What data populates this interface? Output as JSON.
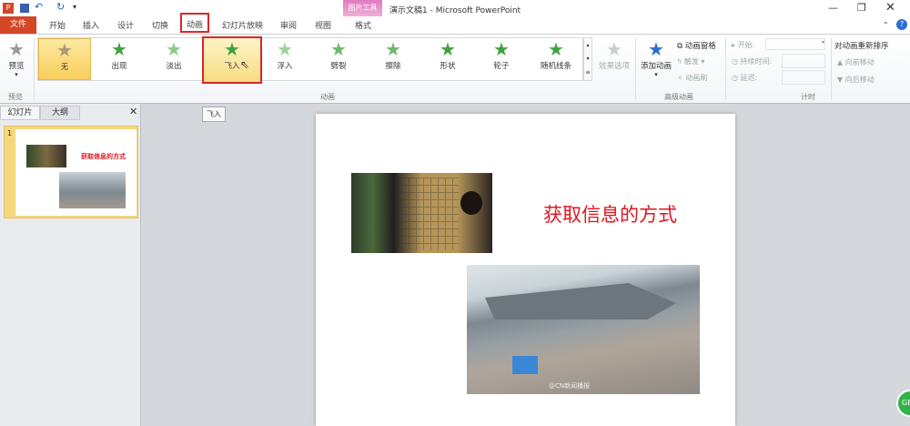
{
  "window": {
    "title": "演示文稿1 - Microsoft PowerPoint",
    "context_group": "图片工具",
    "app_icon": "P"
  },
  "tabs": {
    "file": "文件",
    "items": [
      "开始",
      "插入",
      "设计",
      "切换",
      "动画",
      "幻灯片放映",
      "审阅",
      "视图"
    ],
    "context": "格式"
  },
  "ribbon": {
    "preview": {
      "label": "预览",
      "group": "预览"
    },
    "gallery": [
      "无",
      "出现",
      "淡出",
      "飞入",
      "浮入",
      "劈裂",
      "擦除",
      "形状",
      "轮子",
      "随机线条"
    ],
    "effect_options": "效果选项",
    "group_animation": "动画",
    "add_animation": "添加动画",
    "animation_pane": "动画窗格",
    "trigger": "触发",
    "animation_painter": "动画刷",
    "group_advanced": "高级动画",
    "start_label": "开始:",
    "duration_label": "持续时间:",
    "delay_label": "延迟:",
    "group_timing": "计时",
    "reorder_title": "对动画重新排序",
    "move_earlier": "向前移动",
    "move_later": "向后移动"
  },
  "panel": {
    "tab_slides": "幻灯片",
    "tab_outline": "大纲",
    "slide_number": "1"
  },
  "tooltip": "飞入",
  "slide": {
    "title": "获取信息的方式",
    "watermark": "@CN新闻播报"
  },
  "badge": "GB",
  "colors": {
    "accent": "#d24726",
    "highlight": "#d9262a",
    "title_red": "#e0141e"
  }
}
